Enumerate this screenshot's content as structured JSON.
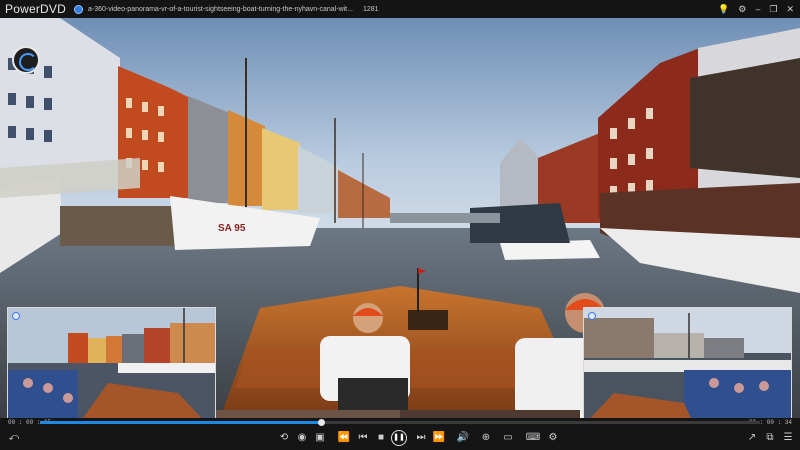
{
  "app": {
    "name": "PowerDVD",
    "file_title": "a-360-video-panorama-vr-of-a-tourist-sightseeing-boat-turning-the-nyhavn-canal-wit...",
    "resolution": "1281"
  },
  "window_controls": [
    {
      "name": "lightbulb-icon",
      "glyph": "💡"
    },
    {
      "name": "gear-icon",
      "glyph": "⚙"
    },
    {
      "name": "minimize-icon",
      "glyph": "–"
    },
    {
      "name": "restore-icon",
      "glyph": "❐"
    },
    {
      "name": "close-icon",
      "glyph": "✕"
    }
  ],
  "scene": {
    "sign_on_boat": "SA 95"
  },
  "playback": {
    "current_time": "00 : 00 : 25",
    "total_time": "00 : 00 : 34",
    "progress": 0.39,
    "accent": "#1e88e5"
  },
  "controls": [
    {
      "name": "back-icon",
      "glyph": "⤺"
    },
    {
      "name": "repeat-icon",
      "glyph": "⟲"
    },
    {
      "name": "view-icon",
      "glyph": "◉"
    },
    {
      "name": "snapshot-icon",
      "glyph": "▣"
    },
    {
      "name": "rewind-icon",
      "glyph": "⏪"
    },
    {
      "name": "prev-icon",
      "glyph": "⏮"
    },
    {
      "name": "stop-icon",
      "glyph": "■"
    },
    {
      "name": "play-pause-icon",
      "glyph": "❚❚"
    },
    {
      "name": "next-icon",
      "glyph": "⏭"
    },
    {
      "name": "fast-forward-icon",
      "glyph": "⏩"
    },
    {
      "name": "volume-icon",
      "glyph": "🔊"
    },
    {
      "name": "zoom-icon",
      "glyph": "⊕"
    },
    {
      "name": "vr-mode-icon",
      "glyph": "▭"
    },
    {
      "name": "subtitle-icon",
      "glyph": "⌨"
    },
    {
      "name": "settings-icon",
      "glyph": "⚙"
    },
    {
      "name": "share-icon",
      "glyph": "↗"
    },
    {
      "name": "cast-icon",
      "glyph": "⧉"
    },
    {
      "name": "menu-icon",
      "glyph": "☰"
    }
  ]
}
